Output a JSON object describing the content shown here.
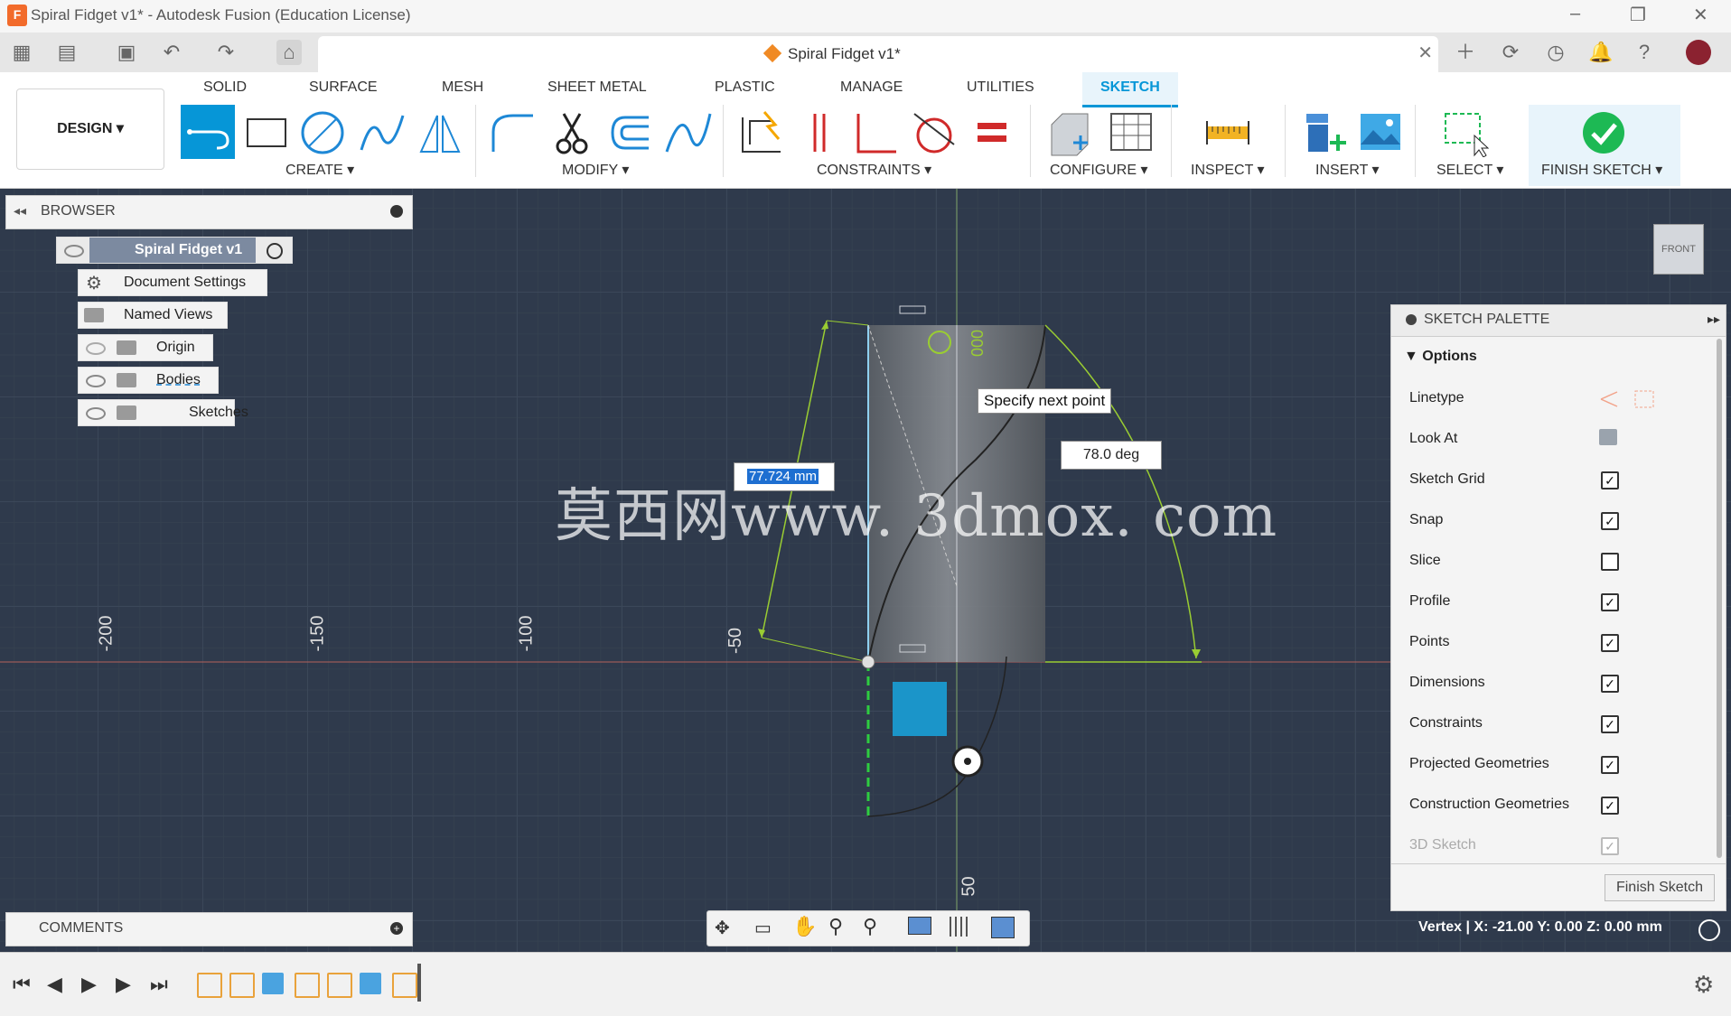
{
  "window": {
    "title": "Spiral Fidget v1* - Autodesk Fusion (Education License)",
    "logo_letter": "F",
    "controls": [
      "–",
      "❐",
      "✕"
    ]
  },
  "document_tab": {
    "name": "Spiral Fidget v1*",
    "close": "✕"
  },
  "design_button": "DESIGN ▾",
  "workspace_tabs": [
    "SOLID",
    "SURFACE",
    "MESH",
    "SHEET METAL",
    "PLASTIC",
    "MANAGE",
    "UTILITIES",
    "SKETCH"
  ],
  "tool_groups": {
    "create": "CREATE ▾",
    "modify": "MODIFY ▾",
    "constraints": "CONSTRAINTS ▾",
    "configure": "CONFIGURE ▾",
    "inspect": "INSPECT ▾",
    "insert": "INSERT ▾",
    "select": "SELECT ▾",
    "finish": "FINISH SKETCH ▾"
  },
  "browser": {
    "title": "BROWSER",
    "root": "Spiral Fidget v1",
    "items": [
      "Document Settings",
      "Named Views",
      "Origin",
      "Bodies",
      "Sketches"
    ]
  },
  "viewport": {
    "tooltip": "Specify next point",
    "angle_dim": "78.0 deg",
    "length_dim": "77.724 mm",
    "watermark": "莫西网www. 3dmox. com",
    "axis_labels": [
      "-200",
      "-150",
      "-100",
      "-50",
      "50"
    ],
    "view_cube": "FRONT"
  },
  "sketch_palette": {
    "title": "SKETCH PALETTE",
    "section": "Options",
    "rows": [
      {
        "label": "Linetype",
        "kind": "icons"
      },
      {
        "label": "Look At",
        "kind": "icon"
      },
      {
        "label": "Sketch Grid",
        "checked": true
      },
      {
        "label": "Snap",
        "checked": true
      },
      {
        "label": "Slice",
        "checked": false
      },
      {
        "label": "Profile",
        "checked": true
      },
      {
        "label": "Points",
        "checked": true
      },
      {
        "label": "Dimensions",
        "checked": true
      },
      {
        "label": "Constraints",
        "checked": true
      },
      {
        "label": "Projected Geometries",
        "checked": true
      },
      {
        "label": "Construction Geometries",
        "checked": true
      },
      {
        "label": "3D Sketch",
        "checked": true,
        "disabled": true
      }
    ],
    "finish_button": "Finish Sketch"
  },
  "comments": {
    "title": "COMMENTS"
  },
  "status": "Vertex | X: -21.00 Y: 0.00 Z: 0.00 mm",
  "colors": {
    "accent": "#0696d7",
    "canvas": "#2f3a4c",
    "finish_green": "#1db954",
    "sketch_green": "#9acd32"
  }
}
